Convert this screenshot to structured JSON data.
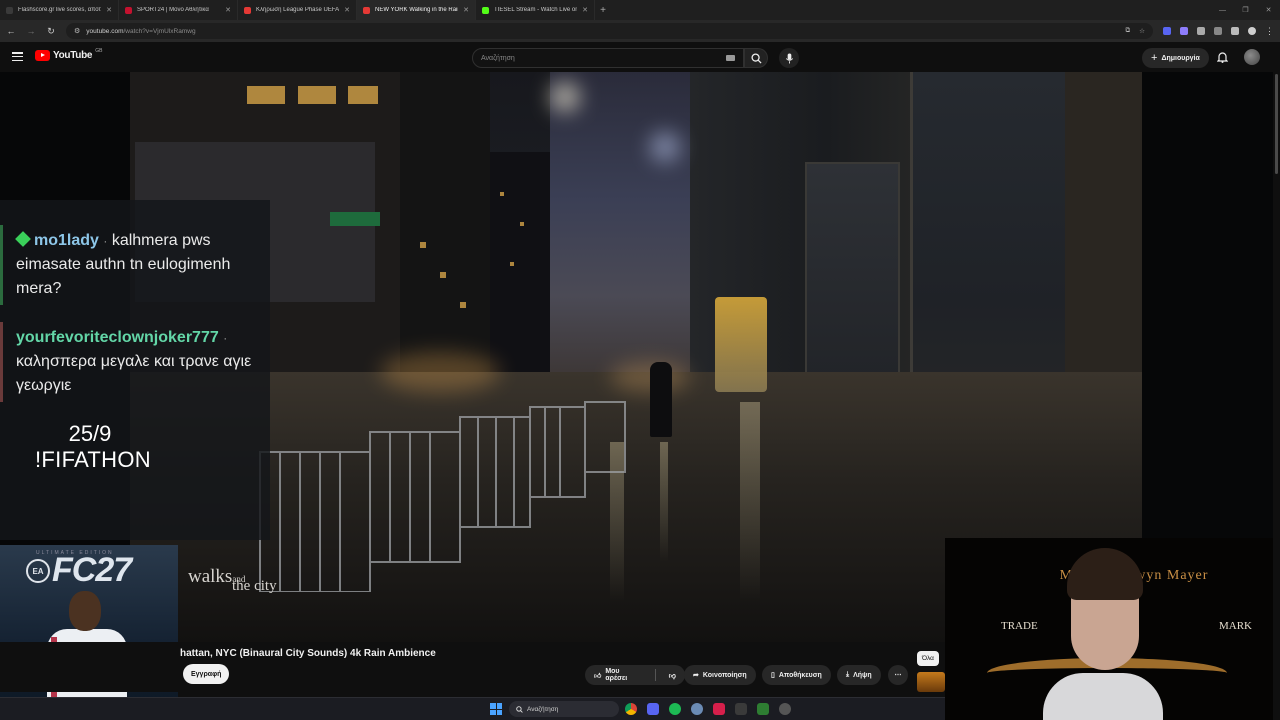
{
  "browser": {
    "tabs": [
      {
        "label": "Flashscore.gr live scores, αποτε",
        "color": "#1f1f1f",
        "icon": "flashscore-icon"
      },
      {
        "label": "SPORT24 | Μόνο Αθλητικά",
        "color": "#c4122f",
        "icon": "sport24-icon"
      },
      {
        "label": "Κλήρωση League Phase UEFA C",
        "color": "#e53935",
        "icon": "youtube-icon"
      },
      {
        "label": "NEW YORK Walking in the Rain",
        "color": "#e53935",
        "icon": "youtube-icon"
      },
      {
        "label": "TIESEL Stream - Watch Live on",
        "color": "#53fc18",
        "icon": "kick-icon"
      }
    ],
    "new_tab_label": "+",
    "url_host": "youtube.com",
    "url_rest": "/watch?v=VjmUlxRamwg"
  },
  "youtube": {
    "logo_text": "YouTube",
    "country": "GB",
    "search_placeholder": "Αναζήτηση",
    "create_label": "Δημιουργία"
  },
  "chat": {
    "messages": [
      {
        "user": "mo1lady",
        "separator": "·",
        "text": "kalhmera pws eimasate authn tn eulogimenh mera?"
      },
      {
        "user": "yourfevoriteclownjoker777",
        "separator": "·",
        "text": "καλησπερα μεγαλε και τρανε αγιε γεωργιε"
      }
    ]
  },
  "overlay": {
    "date": "25/9",
    "command": "!FIFATHON",
    "game_title": "FC27",
    "game_subtitle": "ULTIMATE EDITION",
    "ea_label": "EA",
    "watermark_main": "walks",
    "watermark_and": "and",
    "watermark_city": "the city"
  },
  "webcam": {
    "banner_top": "Metro Goldwyn Mayer",
    "trade": "TRADE",
    "mark": "MARK"
  },
  "video": {
    "title": "hattan, NYC (Binaural City Sounds) 4k Rain Ambience",
    "subscribe_label": "Εγγραφή",
    "like_label": "Μου αρέσει",
    "share_label": "Κοινοποίηση",
    "save_label": "Αποθήκευση",
    "download_label": "Λήψη",
    "chip_all": "Όλα"
  },
  "taskbar": {
    "search_placeholder": "Αναζήτηση"
  }
}
